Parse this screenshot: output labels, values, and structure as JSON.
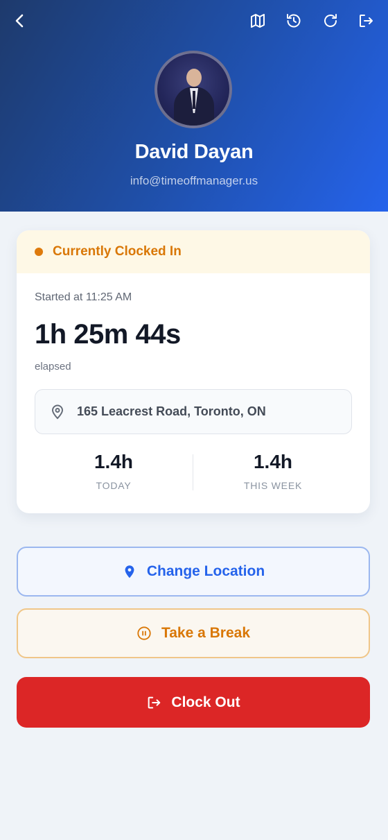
{
  "header": {
    "back_icon": "chevron-left-icon",
    "action_icons": [
      "map-icon",
      "history-icon",
      "refresh-icon",
      "logout-icon"
    ],
    "gradient_colors": [
      "#1e3a6c",
      "#2563eb"
    ]
  },
  "profile": {
    "name": "David Dayan",
    "email": "info@timeoffmanager.us"
  },
  "status_card": {
    "status": "Currently Clocked In",
    "status_color": "#d97706",
    "started": "Started at 11:25 AM",
    "elapsed": "1h 25m 44s",
    "elapsed_label": "elapsed",
    "location": "165 Leacrest Road, Toronto, ON",
    "stats": [
      {
        "value": "1.4h",
        "label": "TODAY"
      },
      {
        "value": "1.4h",
        "label": "THIS WEEK"
      }
    ]
  },
  "actions": {
    "change_location": "Change Location",
    "take_break": "Take a Break",
    "clock_out": "Clock Out",
    "colors": {
      "change_location": "#2563eb",
      "take_break": "#d97706",
      "clock_out": "#dc2626"
    }
  }
}
